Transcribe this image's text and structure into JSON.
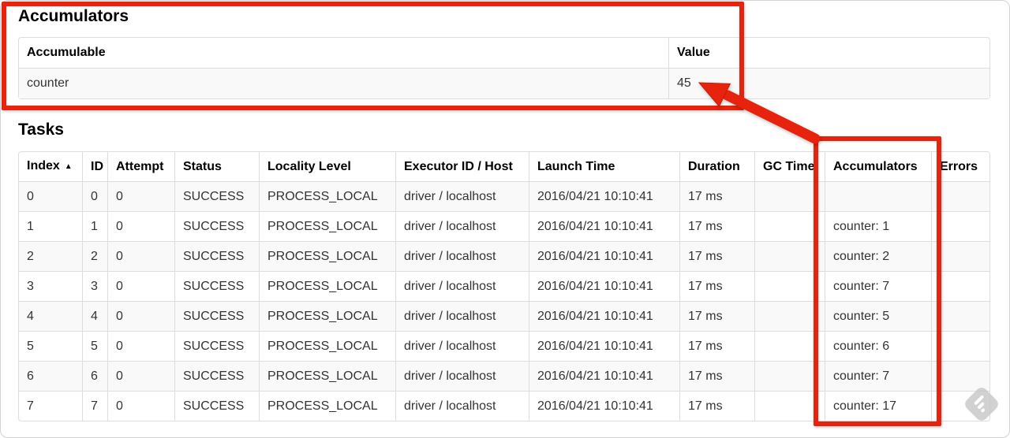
{
  "accumulators_section": {
    "heading": "Accumulators",
    "table": {
      "headers": [
        "Accumulable",
        "Value"
      ],
      "rows": [
        [
          "counter",
          "45"
        ]
      ]
    }
  },
  "tasks_section": {
    "heading": "Tasks",
    "table": {
      "headers": [
        "Index",
        "ID",
        "Attempt",
        "Status",
        "Locality Level",
        "Executor ID / Host",
        "Launch Time",
        "Duration",
        "GC Time",
        "Accumulators",
        "Errors"
      ],
      "sort": {
        "column": "Index",
        "icon": "▲",
        "direction": "ascending"
      },
      "rows": [
        [
          "0",
          "0",
          "0",
          "SUCCESS",
          "PROCESS_LOCAL",
          "driver / localhost",
          "2016/04/21 10:10:41",
          "17 ms",
          "",
          "",
          ""
        ],
        [
          "1",
          "1",
          "0",
          "SUCCESS",
          "PROCESS_LOCAL",
          "driver / localhost",
          "2016/04/21 10:10:41",
          "17 ms",
          "",
          "counter: 1",
          ""
        ],
        [
          "2",
          "2",
          "0",
          "SUCCESS",
          "PROCESS_LOCAL",
          "driver / localhost",
          "2016/04/21 10:10:41",
          "17 ms",
          "",
          "counter: 2",
          ""
        ],
        [
          "3",
          "3",
          "0",
          "SUCCESS",
          "PROCESS_LOCAL",
          "driver / localhost",
          "2016/04/21 10:10:41",
          "17 ms",
          "",
          "counter: 7",
          ""
        ],
        [
          "4",
          "4",
          "0",
          "SUCCESS",
          "PROCESS_LOCAL",
          "driver / localhost",
          "2016/04/21 10:10:41",
          "17 ms",
          "",
          "counter: 5",
          ""
        ],
        [
          "5",
          "5",
          "0",
          "SUCCESS",
          "PROCESS_LOCAL",
          "driver / localhost",
          "2016/04/21 10:10:41",
          "17 ms",
          "",
          "counter: 6",
          ""
        ],
        [
          "6",
          "6",
          "0",
          "SUCCESS",
          "PROCESS_LOCAL",
          "driver / localhost",
          "2016/04/21 10:10:41",
          "17 ms",
          "",
          "counter: 7",
          ""
        ],
        [
          "7",
          "7",
          "0",
          "SUCCESS",
          "PROCESS_LOCAL",
          "driver / localhost",
          "2016/04/21 10:10:41",
          "17 ms",
          "",
          "counter: 17",
          ""
        ]
      ]
    }
  },
  "annotations": {
    "highlight_color": "#e8230d",
    "items": [
      "red box around Accumulators summary section",
      "red box around Tasks Accumulators column",
      "red arrow pointing at accumulator total value 45"
    ]
  }
}
